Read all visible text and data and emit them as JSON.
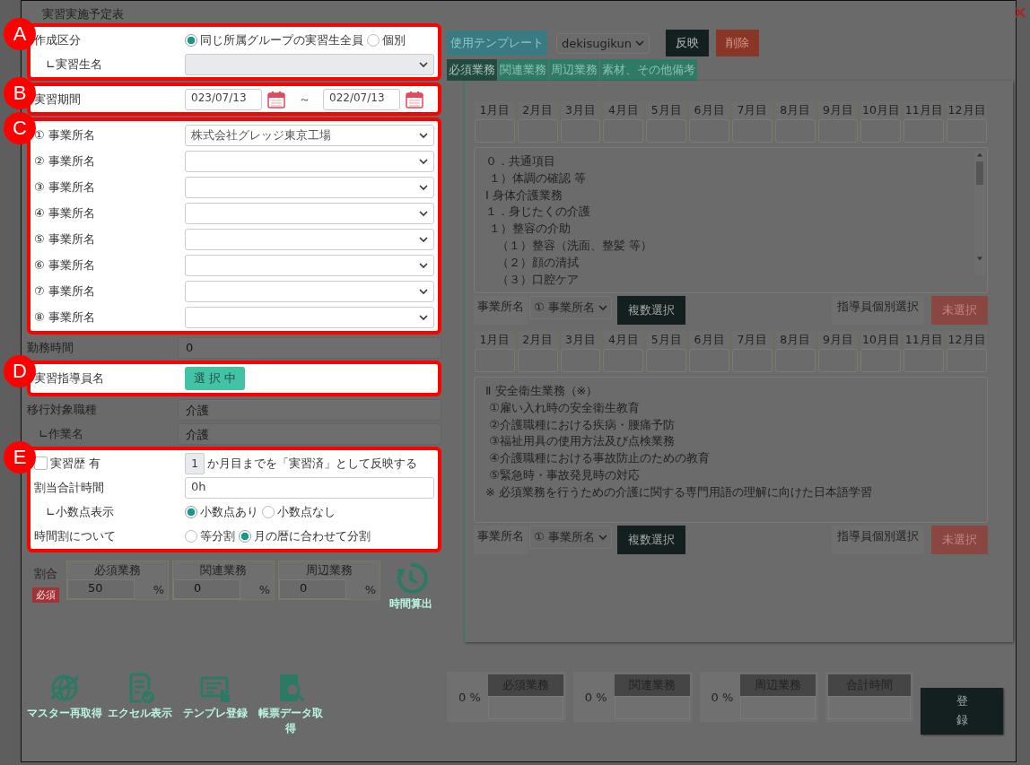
{
  "dialog": {
    "title": "実習実施予定表"
  },
  "callouts": [
    "A",
    "B",
    "C",
    "D",
    "E"
  ],
  "creation": {
    "label": "作成区分",
    "options": [
      {
        "label": "同じ所属グループの実習生全員",
        "selected": true
      },
      {
        "label": "個別",
        "selected": false
      }
    ]
  },
  "trainee": {
    "label": "∟実習生名"
  },
  "period": {
    "label": "実習期間",
    "start": "023/07/13",
    "separator": "～",
    "end": "022/07/13"
  },
  "offices": [
    {
      "label": "① 事業所名",
      "value": "株式会社グレッジ東京工場"
    },
    {
      "label": "② 事業所名"
    },
    {
      "label": "③ 事業所名"
    },
    {
      "label": "④ 事業所名"
    },
    {
      "label": "⑤ 事業所名"
    },
    {
      "label": "⑥ 事業所名"
    },
    {
      "label": "⑦ 事業所名"
    },
    {
      "label": "⑧ 事業所名"
    }
  ],
  "work_hours": {
    "label": "勤務時間",
    "value": "0"
  },
  "instructor": {
    "label": "実習指導員名",
    "button": "選 択 中"
  },
  "job_type": {
    "label": "移行対象職種",
    "value": "介護"
  },
  "task": {
    "label": "∟作業名",
    "value": "介護"
  },
  "history": {
    "label": "実習歴 有",
    "checked": false,
    "months": "1",
    "suffix": "か月目までを「実習済」として反映する"
  },
  "total_hours": {
    "label": "割当合計時間",
    "value": "0h"
  },
  "decimal": {
    "label": "∟小数点表示",
    "options": [
      {
        "label": "小数点あり",
        "selected": true
      },
      {
        "label": "小数点なし",
        "selected": false
      }
    ]
  },
  "split": {
    "label": "時間割について",
    "options": [
      {
        "label": "等分割",
        "selected": false
      },
      {
        "label": "月の暦に合わせて分割",
        "selected": true
      }
    ]
  },
  "ratio": {
    "label": "割合",
    "badge": "必須",
    "columns": [
      {
        "header": "必須業務",
        "value": "50",
        "unit": "%"
      },
      {
        "header": "関連業務",
        "value": "0",
        "unit": "%"
      },
      {
        "header": "周辺業務",
        "value": "0",
        "unit": "%"
      }
    ]
  },
  "calc_button": {
    "label": "時間算出"
  },
  "toolbar": [
    {
      "label": "マスター再取得",
      "kind": "globe"
    },
    {
      "label": "エクセル表示",
      "kind": "sheet"
    },
    {
      "label": "テンプレ登録",
      "kind": "screen"
    },
    {
      "label": "帳票データ取得",
      "kind": "search"
    }
  ],
  "template": {
    "label": "使用テンプレート",
    "value": "dekisugikun",
    "apply": "反映",
    "delete": "削除"
  },
  "tabs": [
    {
      "label": "必須業務",
      "selected": true
    },
    {
      "label": "関連業務",
      "selected": false
    },
    {
      "label": "周辺業務",
      "selected": false
    },
    {
      "label": "素材、その他備考",
      "selected": false
    }
  ],
  "blocks": [
    {
      "months": [
        "1月目",
        "2月目",
        "3月目",
        "4月目",
        "5月目",
        "6月目",
        "7月目",
        "8月目",
        "9月目",
        "10月目",
        "11月目",
        "12月目"
      ],
      "lines": [
        "０．共通項目",
        " １）体調の確認 等",
        "Ⅰ 身体介護業務",
        "１．身じたくの介護",
        " １）整容の介助",
        "　（１）整容（洗面、整髪 等）",
        "　（２）顔の清拭",
        "　（３）口腔ケア"
      ],
      "office_label": "事業所名",
      "office_value": "① 事業所名",
      "multi": "複数選択",
      "individual": "指導員個別選択",
      "status": "未選択"
    },
    {
      "months": [
        "1月目",
        "2月目",
        "3月目",
        "4月目",
        "5月目",
        "6月目",
        "7月目",
        "8月目",
        "9月目",
        "10月目",
        "11月目",
        "12月目"
      ],
      "lines": [
        "Ⅱ 安全衛生業務（※）",
        " ①雇い入れ時の安全衛生教育",
        " ②介護職種における疾病・腰痛予防",
        " ③福祉用具の使用方法及び点検業務",
        " ④介護職種における事故防止のための教育",
        " ⑤緊急時・事故発見時の対応",
        "※ 必須業務を行うための介護に関する専門用語の理解に向けた日本語学習"
      ],
      "office_label": "事業所名",
      "office_value": "① 事業所名",
      "multi": "複数選択",
      "individual": "指導員個別選択",
      "status": "未選択"
    }
  ],
  "totals": [
    {
      "percent": "0 %",
      "label": "必須業務"
    },
    {
      "percent": "0 %",
      "label": "関連業務"
    },
    {
      "percent": "0 %",
      "label": "周辺業務"
    },
    {
      "label": "合計時間"
    }
  ],
  "register": "登録"
}
